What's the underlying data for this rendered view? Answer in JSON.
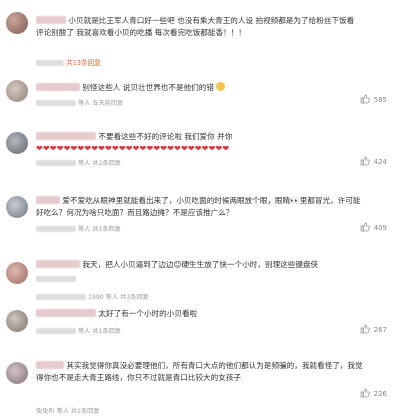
{
  "comments": [
    {
      "lines": [
        "小贝就是比王军人青口好一些吧 也没有乘大青王的人设 拍视频都是为了给粉丝下饭看",
        "评论别酸了 我就喜欢看小贝的吃播 每次看完吃饭都能香！！！"
      ],
      "more": "共13条回复",
      "like": ""
    },
    {
      "lines": [
        "别怪这些人 说贝壮世界也不是他们的错"
      ],
      "meta": "等人 五天前回复",
      "like": "585"
    },
    {
      "lines": [
        "不要看这些不好的评论啦 我们爱你 并你"
      ],
      "hearts": "❤❤❤❤❤❤❤❤❤❤❤❤❤❤❤❤❤❤❤❤❤❤❤❤❤❤❤❤",
      "meta": "等人 共2条回复",
      "like": "424"
    },
    {
      "lines": [
        "爱不爱吃从眼神里就能看出来了，小贝吃面的时候两眼放个眼，眼睛👀里都冒光，许可能",
        "好吃么？何况为啥只吃面？而且路边摊？不是应该推广么？"
      ],
      "meta": "等人 共1条回复",
      "like": "409"
    },
    {
      "lines": [
        "我天，把人小贝逼到了边边😊硬生生放了快一个小时，别理这些键盘侠"
      ],
      "meta": "1990 等人 共3条回复",
      "like": "",
      "meta2": "等人 共1条回复",
      "like2": ""
    },
    {
      "lines": [
        "太好了有一个小时的小贝看啦"
      ],
      "meta": "等人 共1条回复",
      "like": "267"
    },
    {
      "lines": [
        "其实我觉得你真没必要理他们，所有青口大点的他们都认为是频骗的，我就看怪了，我觉",
        "得你也不是走大青王路线，你只不过就是青口比较大的女孩子"
      ],
      "meta": "兔兔叭 等人 共1条回复",
      "like": "226"
    }
  ],
  "icons": {
    "like": "thumbs-up-icon",
    "emoji": "smiley-icon"
  }
}
